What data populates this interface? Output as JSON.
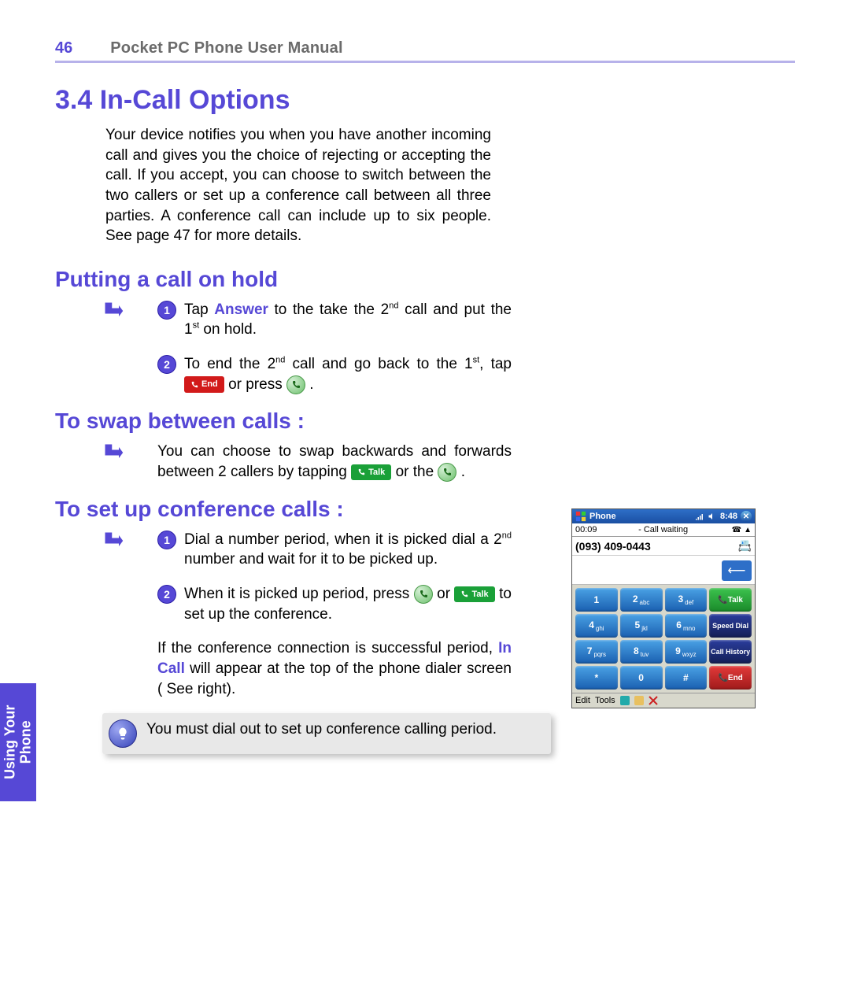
{
  "header": {
    "page_number": "46",
    "running_title": "Pocket PC Phone User Manual"
  },
  "section": {
    "title": "3.4  In-Call Options",
    "intro": "Your device notifies you when you have another incoming call and gives you the choice of rejecting or accepting the call.  If you accept, you can choose to switch between the two callers or set up a conference call between all three parties. A conference call can include up to six people. See page 47 for more details."
  },
  "hold": {
    "title": "Putting a call on hold",
    "step1_pre": "Tap ",
    "step1_link": "Answer",
    "step1_post": " to the take the 2",
    "step1_sup1": "nd",
    "step1_mid": " call and put the 1",
    "step1_sup2": "st",
    "step1_end": " on hold.",
    "step2_pre": "To end the 2",
    "step2_sup1": "nd",
    "step2_mid": " call and go back to the 1",
    "step2_sup2": "st",
    "step2_post": ", tap ",
    "step2_btn": "End",
    "step2_or": " or press ",
    "step2_end": " ."
  },
  "swap": {
    "title": "To swap between calls :",
    "text_pre": "You can choose to swap backwards and forwards between 2 callers by tapping ",
    "talk_btn": "Talk",
    "text_mid": " or  the ",
    "text_end": " ."
  },
  "conf": {
    "title": "To set up conference calls :",
    "step1_pre": "Dial a number period, when it is picked dial a 2",
    "step1_sup": "nd",
    "step1_post": " number and wait for it to be picked up.",
    "step2_pre": "When  it  is  picked  up  period,  press ",
    "step2_or": "  or ",
    "talk_btn": "Talk",
    "step2_post": "  to set up the conference.",
    "note_pre": "If the conference connection is successful period, ",
    "note_link": "In Call",
    "note_post": " will appear at the top of the phone dialer screen ( See right).",
    "tip": "You must dial out to set up conference calling period."
  },
  "side_tab": {
    "line1": "Using Your",
    "line2": "Phone"
  },
  "screenshot": {
    "titlebar_app": "Phone",
    "titlebar_time": "8:48",
    "status_left": "00:09",
    "status_right": "- Call waiting",
    "number": "(093) 409-0443",
    "keys": {
      "r1": [
        "1",
        "2abc",
        "3def"
      ],
      "r1_side": "Talk",
      "r2": [
        "4ghi",
        "5jkl",
        "6mno"
      ],
      "r2_side": "Speed Dial",
      "r3": [
        "7pqrs",
        "8tuv",
        "9wxyz"
      ],
      "r3_side": "Call History",
      "r4": [
        "*",
        "0",
        "#"
      ],
      "r4_side": "End"
    },
    "menu": {
      "edit": "Edit",
      "tools": "Tools"
    }
  }
}
